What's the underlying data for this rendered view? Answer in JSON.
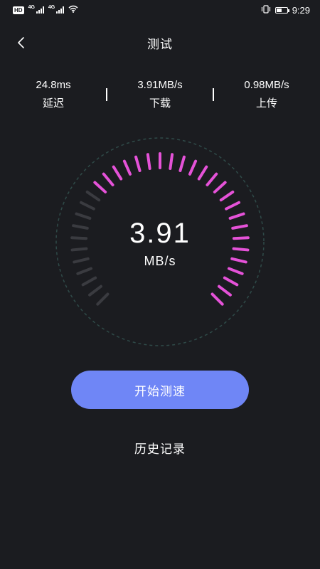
{
  "status_bar": {
    "hd_badge": "HD",
    "network_tags": [
      "4G",
      "4G"
    ],
    "time": "9:29",
    "icons": [
      "hd-icon",
      "signal-icon",
      "signal-icon",
      "wifi-icon",
      "vibrate-icon",
      "battery-icon"
    ]
  },
  "header": {
    "title": "测试",
    "back_icon": "chevron-left-icon"
  },
  "stats": {
    "latency": {
      "value": "24.8ms",
      "label": "延迟"
    },
    "download": {
      "value": "3.91MB/s",
      "label": "下载"
    },
    "upload": {
      "value": "0.98MB/s",
      "label": "上传"
    }
  },
  "gauge": {
    "value": "3.91",
    "unit": "MB/s",
    "fill_fraction": 0.7,
    "colors": {
      "active": "#e552d8",
      "inactive": "#3a3b40",
      "outer_ring": "#2f4a48"
    }
  },
  "actions": {
    "start_label": "开始测速",
    "history_label": "历史记录"
  },
  "colors": {
    "background": "#1b1c20",
    "accent": "#6f86f6"
  }
}
